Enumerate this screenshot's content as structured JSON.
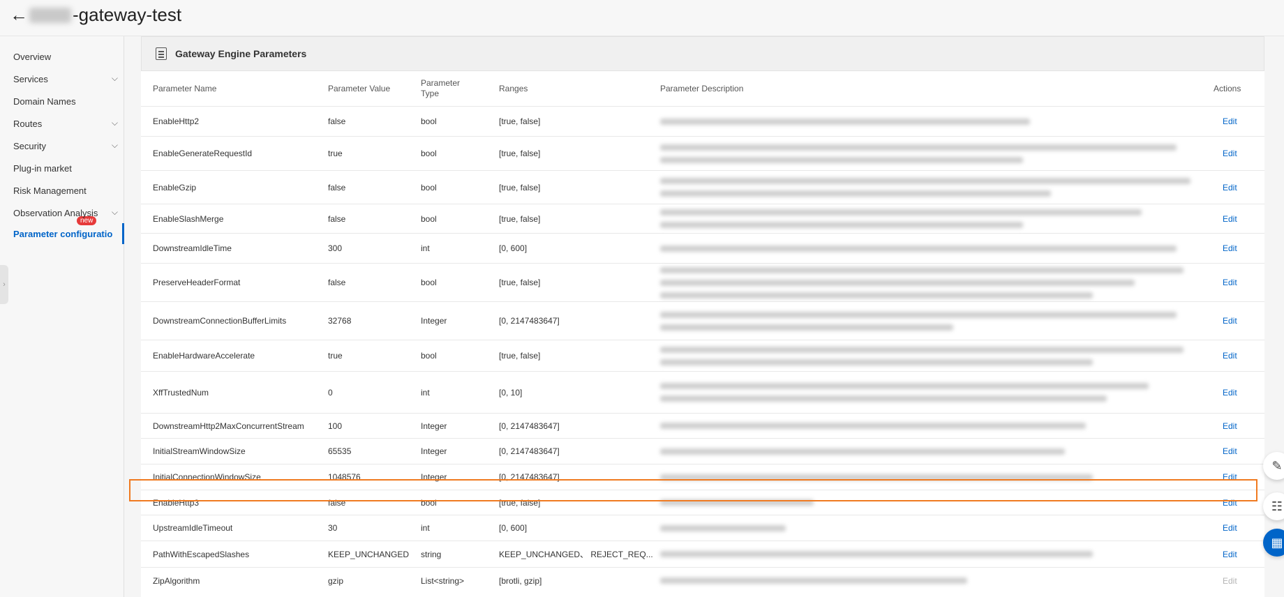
{
  "header": {
    "title_suffix": "-gateway-test"
  },
  "sidebar": {
    "items": [
      {
        "label": "Overview",
        "chevron": false
      },
      {
        "label": "Services",
        "chevron": true
      },
      {
        "label": "Domain Names",
        "chevron": false
      },
      {
        "label": "Routes",
        "chevron": true
      },
      {
        "label": "Security",
        "chevron": true
      },
      {
        "label": "Plug-in market",
        "chevron": false
      },
      {
        "label": "Risk Management",
        "chevron": false
      },
      {
        "label": "Observation Analysis",
        "chevron": true
      },
      {
        "label": "Parameter configuratio",
        "chevron": false
      }
    ],
    "new_badge": "new"
  },
  "panel": {
    "title": "Gateway Engine Parameters"
  },
  "table": {
    "columns": {
      "name": "Parameter Name",
      "value": "Parameter Value",
      "type_line1": "Parameter",
      "type_line2": "Type",
      "ranges": "Ranges",
      "description": "Parameter Description",
      "actions": "Actions"
    },
    "edit_label": "Edit",
    "rows": [
      {
        "name": "EnableHttp2",
        "value": "false",
        "type": "bool",
        "ranges": "[true, false]"
      },
      {
        "name": "EnableGenerateRequestId",
        "value": "true",
        "type": "bool",
        "ranges": "[true, false]"
      },
      {
        "name": "EnableGzip",
        "value": "false",
        "type": "bool",
        "ranges": "[true, false]"
      },
      {
        "name": "EnableSlashMerge",
        "value": "false",
        "type": "bool",
        "ranges": "[true, false]"
      },
      {
        "name": "DownstreamIdleTime",
        "value": "300",
        "type": "int",
        "ranges": "[0, 600]"
      },
      {
        "name": "PreserveHeaderFormat",
        "value": "false",
        "type": "bool",
        "ranges": "[true, false]"
      },
      {
        "name": "DownstreamConnectionBufferLimits",
        "value": "32768",
        "type": "Integer",
        "ranges": "[0, 2147483647]"
      },
      {
        "name": "EnableHardwareAccelerate",
        "value": "true",
        "type": "bool",
        "ranges": "[true, false]"
      },
      {
        "name": "XffTrustedNum",
        "value": "0",
        "type": "int",
        "ranges": "[0, 10]"
      },
      {
        "name": "DownstreamHttp2MaxConcurrentStream",
        "value": "100",
        "type": "Integer",
        "ranges": "[0, 2147483647]"
      },
      {
        "name": "InitialStreamWindowSize",
        "value": "65535",
        "type": "Integer",
        "ranges": "[0, 2147483647]"
      },
      {
        "name": "InitialConnectionWindowSize",
        "value": "1048576",
        "type": "Integer",
        "ranges": "[0, 2147483647]"
      },
      {
        "name": "EnableHttp3",
        "value": "false",
        "type": "bool",
        "ranges": "[true, false]"
      },
      {
        "name": "UpstreamIdleTimeout",
        "value": "30",
        "type": "int",
        "ranges": "[0, 600]"
      },
      {
        "name": "PathWithEscapedSlashes",
        "value": "KEEP_UNCHANGED",
        "type": "string",
        "ranges": "KEEP_UNCHANGED、 REJECT_REQ..."
      },
      {
        "name": "ZipAlgorithm",
        "value": "gzip",
        "type": "List<string>",
        "ranges": "[brotli, gzip]"
      }
    ]
  },
  "icons": {
    "back": "back-arrow-icon",
    "doc": "document-icon",
    "edit_float": "pencil-icon",
    "feedback": "chat-icon",
    "apps": "apps-icon"
  },
  "colors": {
    "accent": "#0064c8",
    "highlight": "#f07a20",
    "badge": "#e63a3a"
  }
}
